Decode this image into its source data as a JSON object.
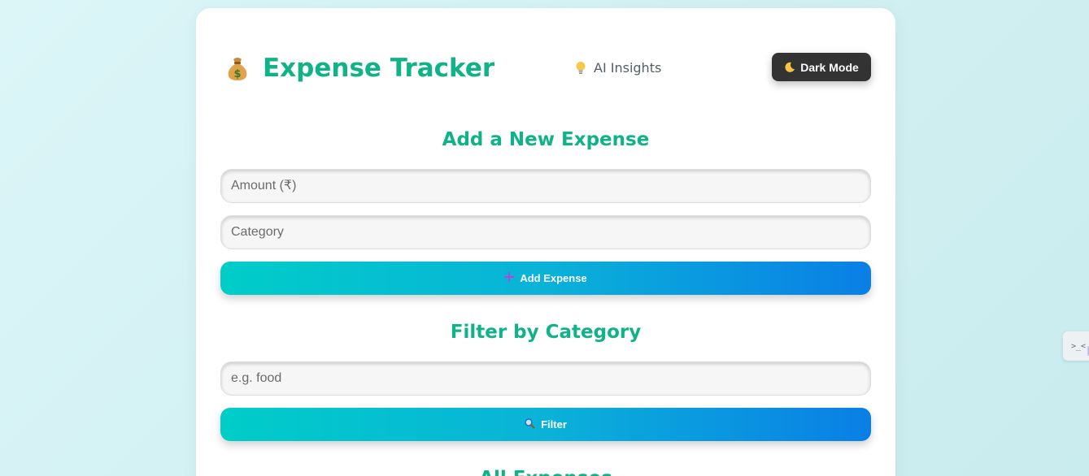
{
  "header": {
    "title": "Expense Tracker",
    "icon": "money-bag-icon",
    "ai_insights": "AI Insights",
    "dark_mode_label": "Dark Mode"
  },
  "add_expense": {
    "heading": "Add a New Expense",
    "amount_placeholder": "Amount (₹)",
    "category_placeholder": "Category",
    "button_label": "Add Expense"
  },
  "filter": {
    "heading": "Filter by Category",
    "input_placeholder": "e.g. food",
    "button_label": "Filter"
  },
  "all_expenses": {
    "heading": "All Expenses"
  },
  "side_tab": {
    "label": ">_<"
  },
  "colors": {
    "accent": "#10b387",
    "button_gradient_start": "#00cdc8",
    "button_gradient_end": "#0a7fe6",
    "dark_button": "#333333"
  }
}
